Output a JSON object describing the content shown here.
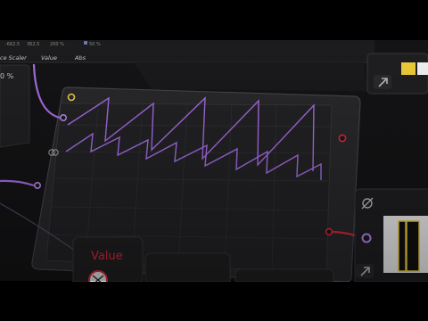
{
  "top_bar": {
    "readouts": [
      "-662.5",
      "362.5",
      "200 %",
      "50 %"
    ],
    "labels": [
      "ce Scaler",
      "Value",
      "Abs"
    ],
    "left_value": "0 %"
  },
  "value_panel": {
    "title": "Value"
  },
  "colors": {
    "background": "#000000",
    "panel": "#252527",
    "panel_border": "#3c3c40",
    "wave": "#a86ee6",
    "port_purple": "#b98cf0",
    "port_yellow": "#f0d24a",
    "port_red": "#e0283c",
    "swatch_yellow": "#f0cf3a"
  },
  "icons": {
    "null_port": "empty-set-icon",
    "sync_port": "link-rings-icon",
    "corner_arrow": "corner-arrow-icon",
    "knob": "knob-icon"
  }
}
